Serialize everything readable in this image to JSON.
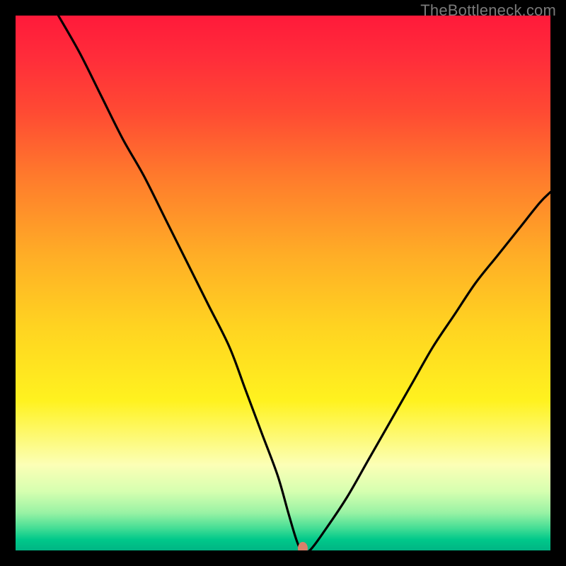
{
  "attribution": "TheBottleneck.com",
  "chart_data": {
    "type": "line",
    "title": "",
    "xlabel": "",
    "ylabel": "",
    "xlim": [
      0,
      100
    ],
    "ylim": [
      0,
      100
    ],
    "grid": false,
    "series": [
      {
        "name": "curve",
        "x": [
          8,
          12,
          16,
          20,
          24,
          28,
          32,
          36,
          40,
          43,
          46,
          49,
          51,
          52.5,
          53.5,
          55,
          58,
          62,
          66,
          70,
          74,
          78,
          82,
          86,
          90,
          94,
          98,
          100
        ],
        "y": [
          100,
          93,
          85,
          77,
          70,
          62,
          54,
          46,
          38,
          30,
          22,
          14,
          7,
          2,
          0,
          0,
          4,
          10,
          17,
          24,
          31,
          38,
          44,
          50,
          55,
          60,
          65,
          67
        ]
      }
    ],
    "marker": {
      "x": 53.7,
      "y": 0,
      "color": "#d9806a"
    },
    "gradient_stops": [
      {
        "pos": 0,
        "color": "#ff1a3a"
      },
      {
        "pos": 8,
        "color": "#ff2d3a"
      },
      {
        "pos": 18,
        "color": "#ff4a33"
      },
      {
        "pos": 30,
        "color": "#ff7a2c"
      },
      {
        "pos": 45,
        "color": "#ffae26"
      },
      {
        "pos": 58,
        "color": "#ffd321"
      },
      {
        "pos": 72,
        "color": "#fff21f"
      },
      {
        "pos": 84,
        "color": "#fcffb6"
      },
      {
        "pos": 89,
        "color": "#d6ffb0"
      },
      {
        "pos": 93,
        "color": "#98f2a4"
      },
      {
        "pos": 96,
        "color": "#3fdc94"
      },
      {
        "pos": 98,
        "color": "#00c88a"
      },
      {
        "pos": 100,
        "color": "#00b584"
      }
    ]
  }
}
